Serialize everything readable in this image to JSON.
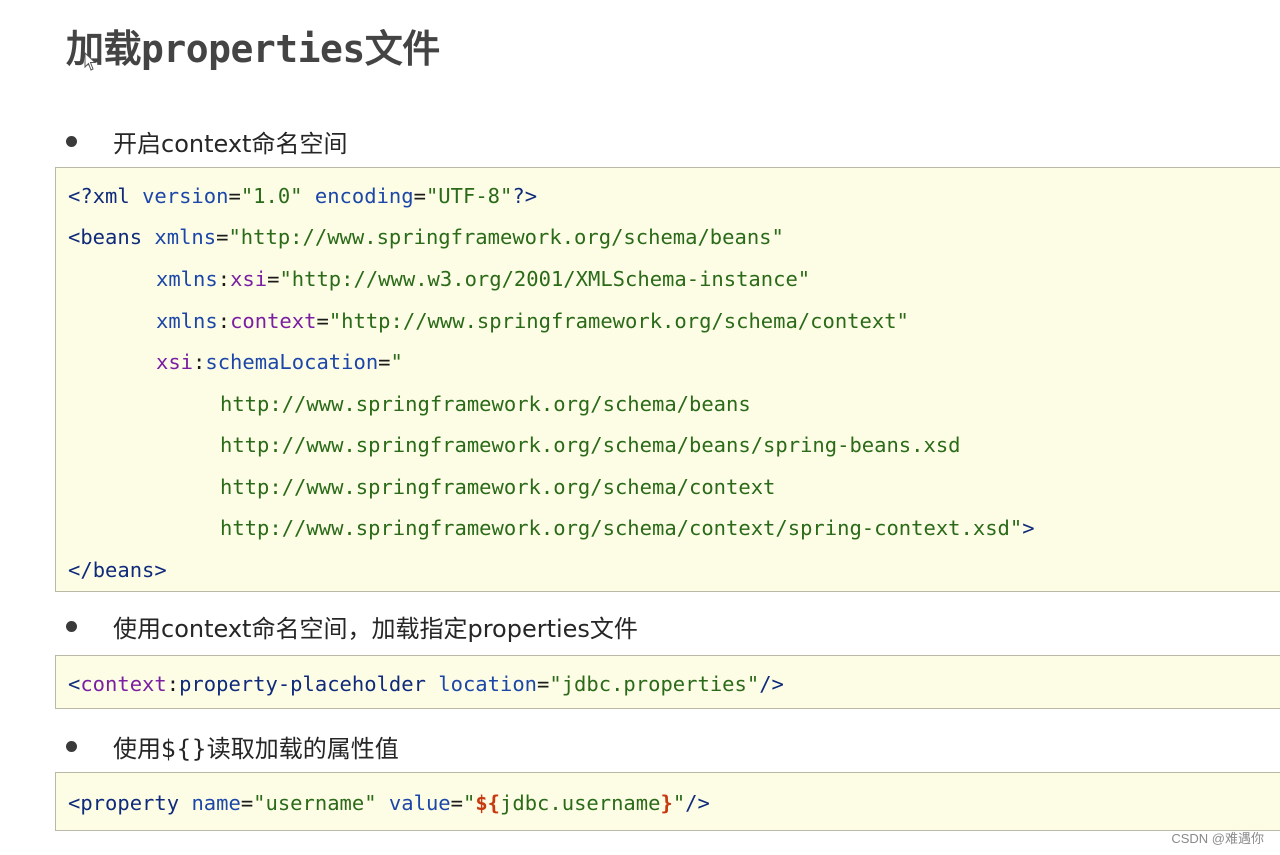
{
  "title": "加载properties文件",
  "bullets": [
    "开启context命名空间",
    "使用context命名空间，加载指定properties文件",
    "使用${}读取加载的属性值"
  ],
  "code1": {
    "l1": {
      "open": "<?",
      "tag": "xml",
      "a1": "version",
      "eq1": "=",
      "v1": "\"1.0\"",
      "a2": "encoding",
      "eq2": "=",
      "v2": "\"UTF-8\"",
      "close": "?>"
    },
    "l2": {
      "open": "<",
      "tag": "beans",
      "attr": "xmlns",
      "eq": "=",
      "val": "\"http://www.springframework.org/schema/beans\""
    },
    "l3": {
      "prefix": "xmlns",
      "colon": ":",
      "local": "xsi",
      "eq": "=",
      "val": "\"http://www.w3.org/2001/XMLSchema-instance\""
    },
    "l4": {
      "prefix": "xmlns",
      "colon": ":",
      "local": "context",
      "eq": "=",
      "val": "\"http://www.springframework.org/schema/context\""
    },
    "l5": {
      "prefix": "xsi",
      "colon": ":",
      "local": "schemaLocation",
      "eq": "=",
      "val": "\""
    },
    "l6": {
      "val": "http://www.springframework.org/schema/beans"
    },
    "l7": {
      "val": "http://www.springframework.org/schema/beans/spring-beans.xsd"
    },
    "l8": {
      "val": "http://www.springframework.org/schema/context"
    },
    "l9": {
      "val": "http://www.springframework.org/schema/context/spring-context.xsd\"",
      "close": ">"
    },
    "l10": {
      "open": "</",
      "tag": "beans",
      "close": ">"
    }
  },
  "code2": {
    "open": "<",
    "ns": "context",
    "colon": ":",
    "tag": "property-placeholder",
    "attr": "location",
    "eq": "=",
    "val": "\"jdbc.properties\"",
    "close": "/>"
  },
  "code3": {
    "open": "<",
    "tag": "property",
    "a1": "name",
    "eq1": "=",
    "v1": "\"username\"",
    "a2": "value",
    "eq2": "=",
    "q1": "\"",
    "var_open": "${",
    "var_name": "jdbc.username",
    "var_close": "}",
    "q2": "\"",
    "close": "/>"
  },
  "watermark": "CSDN @难遇你",
  "colors": {
    "code_bg": "#fdfde6",
    "tag": "#0f2a7a",
    "attr": "#1c47a8",
    "value": "#2a6a18",
    "namespace": "#7b1fa2",
    "variable": "#c7390f"
  }
}
